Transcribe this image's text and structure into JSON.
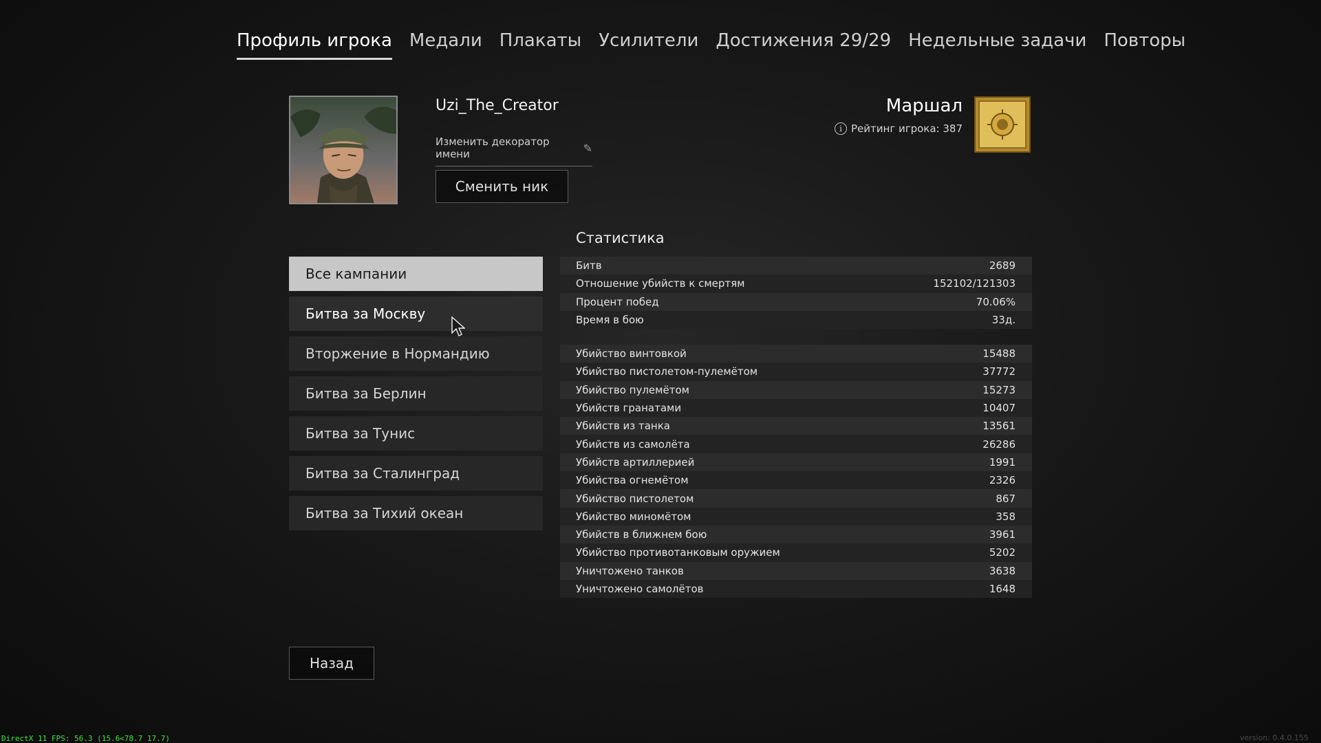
{
  "tabs": [
    {
      "label": "Профиль игрока",
      "active": true
    },
    {
      "label": "Медали"
    },
    {
      "label": "Плакаты"
    },
    {
      "label": "Усилители"
    },
    {
      "label": "Достижения 29/29"
    },
    {
      "label": "Недельные задачи"
    },
    {
      "label": "Повторы"
    }
  ],
  "profile": {
    "username": "Uzi_The_Creator",
    "decorator_label": "Изменить декоратор имени",
    "change_nick_label": "Сменить ник",
    "rank_title": "Маршал",
    "rating_label": "Рейтинг игрока: 387"
  },
  "campaigns": [
    {
      "label": "Все кампании",
      "state": "active"
    },
    {
      "label": "Битва за Москву",
      "state": "hover"
    },
    {
      "label": "Вторжение в Нормандию"
    },
    {
      "label": "Битва за Берлин"
    },
    {
      "label": "Битва за Тунис"
    },
    {
      "label": "Битва за Сталинград"
    },
    {
      "label": "Битва за Тихий океан"
    }
  ],
  "stats": {
    "title": "Статистика",
    "summary": [
      {
        "label": "Битв",
        "value": "2689"
      },
      {
        "label": "Отношение убийств к смертям",
        "value": "152102/121303"
      },
      {
        "label": "Процент побед",
        "value": "70.06%"
      },
      {
        "label": "Время в бою",
        "value": "33д."
      }
    ],
    "kills": [
      {
        "label": "Убийство винтовкой",
        "value": "15488"
      },
      {
        "label": "Убийство пистолетом-пулемётом",
        "value": "37772"
      },
      {
        "label": "Убийство пулемётом",
        "value": "15273"
      },
      {
        "label": "Убийств гранатами",
        "value": "10407"
      },
      {
        "label": "Убийств из танка",
        "value": "13561"
      },
      {
        "label": "Убийств из самолёта",
        "value": "26286"
      },
      {
        "label": "Убийств артиллерией",
        "value": "1991"
      },
      {
        "label": "Убийства огнемётом",
        "value": "2326"
      },
      {
        "label": "Убийство пистолетом",
        "value": "867"
      },
      {
        "label": "Убийство миномётом",
        "value": "358"
      },
      {
        "label": "Убийств в ближнем бою",
        "value": "3961"
      },
      {
        "label": "Убийство противотанковым оружием",
        "value": "5202"
      },
      {
        "label": "Уничтожено танков",
        "value": "3638"
      },
      {
        "label": "Уничтожено самолётов",
        "value": "1648"
      }
    ]
  },
  "footer": {
    "back_label": "Назад",
    "fps_text": "DirectX 11 FPS: 56.3 (15.6<78.7 17.7)",
    "version_text": "version: 0.4.0.155"
  },
  "icons": {
    "info": "info-icon",
    "pencil": "pencil-icon",
    "rank": "marshal-rank-icon",
    "cursor": "mouse-cursor-icon"
  },
  "colors": {
    "active_campaign_bg": "#c7c7c7",
    "fps_green": "#3ee83e",
    "rank_gold": "#c9a13a"
  }
}
